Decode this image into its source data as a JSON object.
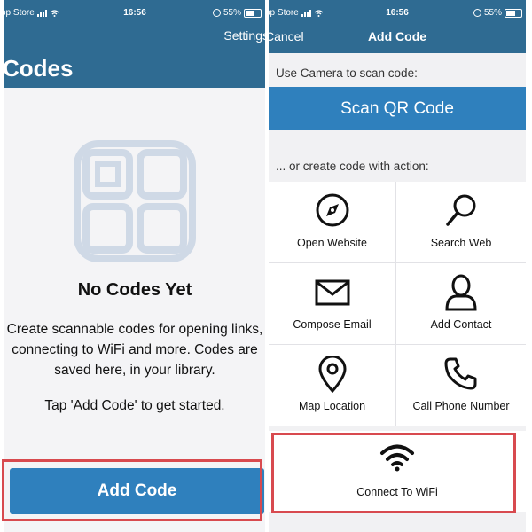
{
  "status_left": {
    "carrier": "pp Store",
    "time": "16:56",
    "battery": "55%"
  },
  "status_right": {
    "carrier": "pp Store",
    "time": "16:56",
    "battery": "55%"
  },
  "codes_screen": {
    "settings_label": "Settings",
    "title": "Codes",
    "empty_icon": "grid-squares-icon",
    "empty_title": "No Codes Yet",
    "empty_body": "Create scannable codes for opening links, connecting to WiFi and more. Codes are saved here, in your library.",
    "empty_hint": "Tap 'Add Code' to get started.",
    "add_button": "Add Code"
  },
  "add_code_screen": {
    "cancel_label": "Cancel",
    "title": "Add Code",
    "camera_section_label": "Use Camera to scan code:",
    "scan_button": "Scan QR Code",
    "action_section_label": "... or create code with action:",
    "actions": [
      {
        "label": "Open Website",
        "icon": "compass-icon"
      },
      {
        "label": "Search Web",
        "icon": "magnifier-icon"
      },
      {
        "label": "Compose Email",
        "icon": "envelope-icon"
      },
      {
        "label": "Add Contact",
        "icon": "person-icon"
      },
      {
        "label": "Map Location",
        "icon": "map-pin-icon"
      },
      {
        "label": "Call Phone Number",
        "icon": "phone-icon"
      }
    ],
    "wifi_action": {
      "label": "Connect To WiFi",
      "icon": "wifi-icon"
    }
  },
  "colors": {
    "header": "#2f6b92",
    "button": "#2f80bd",
    "highlight": "#d84a4f"
  }
}
